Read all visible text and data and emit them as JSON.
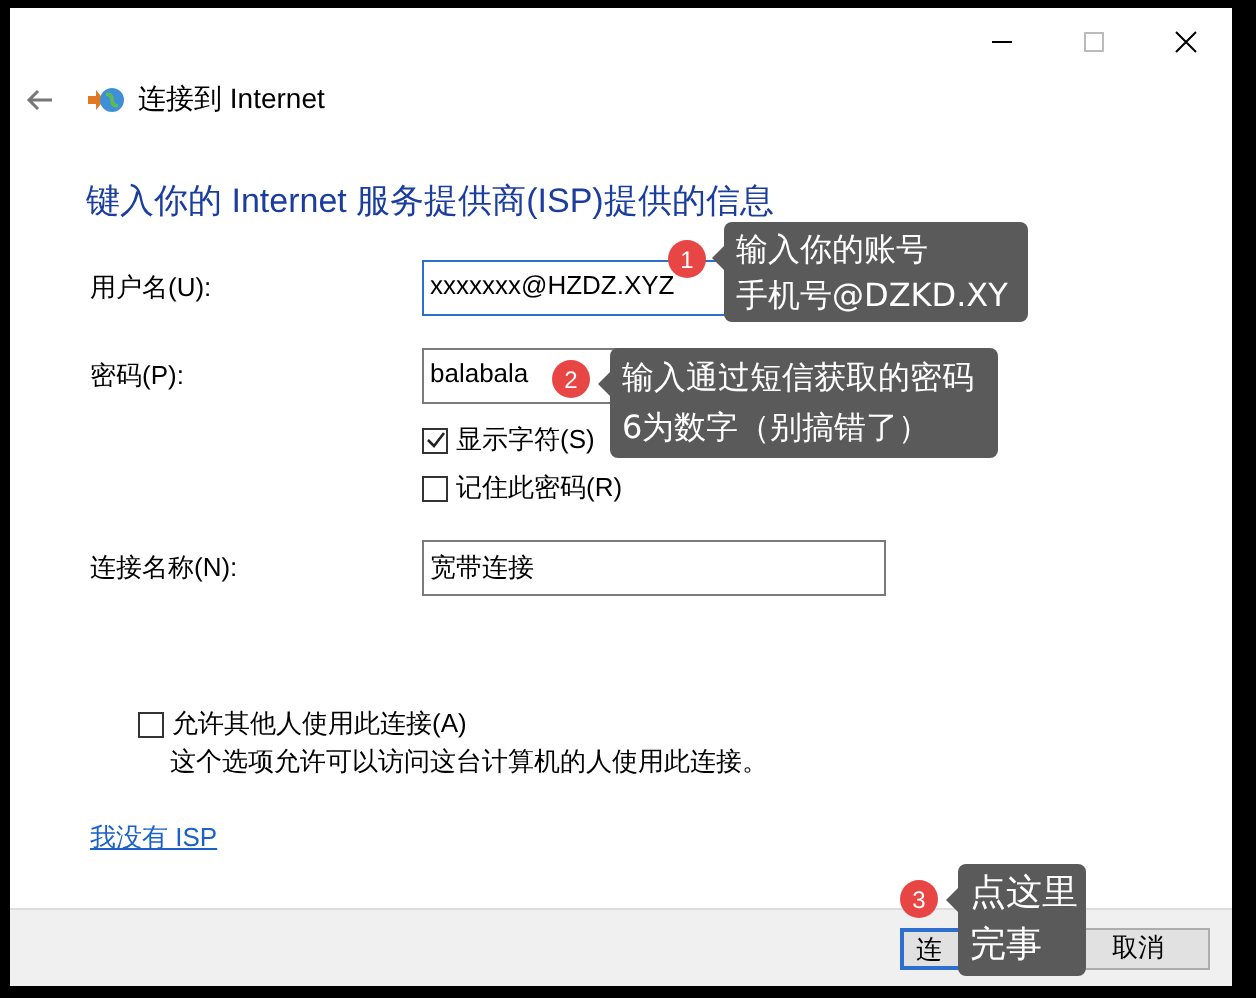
{
  "header": {
    "title": "连接到 Internet"
  },
  "heading": "键入你的 Internet 服务提供商(ISP)提供的信息",
  "fields": [
    {
      "label": "用户名(U):",
      "value": "xxxxxxx@HZDZ.XYZ",
      "focused": true
    },
    {
      "label": "密码(P):",
      "value": "balabala",
      "focused": false
    }
  ],
  "options": [
    {
      "label": "显示字符(S)",
      "checked": true
    },
    {
      "label": "记住此密码(R)",
      "checked": false
    }
  ],
  "connection_name": {
    "label": "连接名称(N):",
    "value": "宽带连接"
  },
  "share": {
    "label": "允许其他人使用此连接(A)",
    "checked": false,
    "note": "这个选项允许可以访问这台计算机的人使用此连接。"
  },
  "link": "我没有 ISP",
  "buttons": [
    {
      "label": "连",
      "default": true
    },
    {
      "label": "取消",
      "default": false
    }
  ],
  "callouts": [
    {
      "number": "1",
      "lines": [
        "输入你的账号",
        "手机号@DZKD.XY"
      ]
    },
    {
      "number": "2",
      "lines": [
        "输入通过短信获取的密码",
        "6为数字（别搞错了）"
      ]
    },
    {
      "number": "3",
      "lines": [
        "点这里",
        "完事"
      ]
    }
  ]
}
